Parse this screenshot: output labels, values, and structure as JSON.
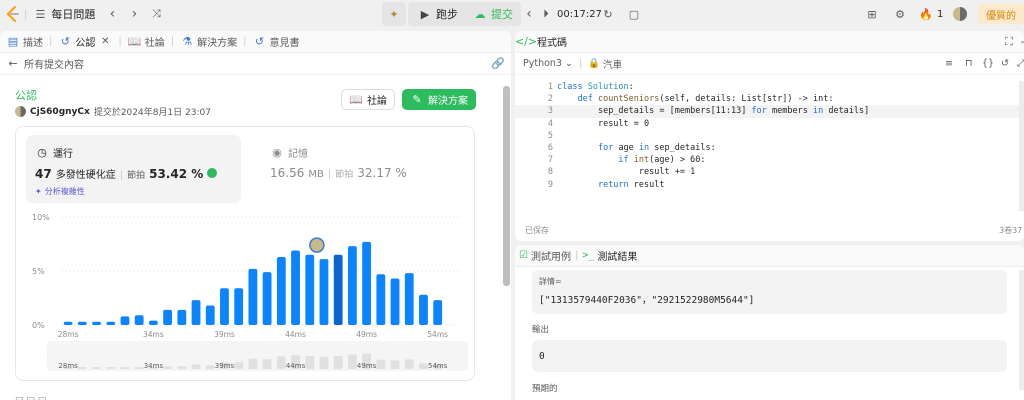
{
  "topbar": {
    "problem_list_label": "每日問題",
    "run_label": "跑步",
    "submit_label": "提交",
    "timer": "00:17:27",
    "streak": "1",
    "premium_label": "優質的"
  },
  "left_tabs": [
    {
      "label": "描述",
      "icon": "description-icon"
    },
    {
      "label": "公認",
      "icon": "history-icon"
    },
    {
      "label": "社論",
      "icon": "book-icon"
    },
    {
      "label": "解決方案",
      "icon": "flask-icon"
    },
    {
      "label": "意見書",
      "icon": "history-icon"
    }
  ],
  "back_label": "所有提交內容",
  "submission": {
    "status": "公認",
    "author": "CjS60gnyCx",
    "submitted_at": "提交於2024年8月1日 23:07",
    "forum_label": "社論",
    "solution_label": "解決方案"
  },
  "runtime": {
    "title": "運行",
    "value": "47",
    "unit": "多發性硬化症",
    "beats_label": "節拍",
    "beats_value": "53.42 %",
    "analyze_label": "分析複雜性"
  },
  "memory": {
    "title": "記憶",
    "value": "16.56",
    "unit": "MB",
    "beats_label": "節拍",
    "beats_value": "32.17 %"
  },
  "chart_data": {
    "type": "bar",
    "categories": [
      "28ms",
      "29ms",
      "30ms",
      "31ms",
      "32ms",
      "33ms",
      "34ms",
      "35ms",
      "36ms",
      "37ms",
      "38ms",
      "39ms",
      "40ms",
      "41ms",
      "42ms",
      "43ms",
      "44ms",
      "45ms",
      "46ms",
      "47ms",
      "48ms",
      "49ms",
      "50ms",
      "51ms",
      "52ms",
      "53ms",
      "54ms",
      "55ms"
    ],
    "values": [
      0.3,
      0.3,
      0.3,
      0.3,
      0.8,
      0.9,
      0.4,
      1.4,
      1.4,
      2.3,
      1.8,
      3.4,
      3.4,
      5.2,
      4.9,
      6.3,
      6.9,
      6.5,
      6.1,
      6.5,
      7.3,
      7.7,
      4.7,
      4.3,
      4.8,
      2.8,
      2.3,
      0
    ],
    "highlight_index": 19,
    "x_tick_labels": [
      "28ms",
      "34ms",
      "39ms",
      "44ms",
      "49ms",
      "54ms"
    ],
    "y_tick_labels": [
      "10%",
      "5%",
      "0%"
    ],
    "ylim": [
      0,
      10
    ],
    "grid": true,
    "overview_tick_labels": [
      "28ms",
      "34ms",
      "39ms",
      "44ms",
      "49ms",
      "54ms"
    ]
  },
  "editor": {
    "title": "程式碼",
    "language": "Python3",
    "mode": "汽車",
    "lines": [
      "class Solution:",
      "    def countSeniors(self, details: List[str]) -> int:",
      "        sep_details = [members[11:13] for members in details]",
      "        result = 0",
      "",
      "        for age in sep_details:",
      "            if int(age) > 60:",
      "                result += 1",
      "        return result"
    ],
    "saved_label": "已保存",
    "position_label": "3卷37"
  },
  "console": {
    "tab_cases": "測試用例",
    "tab_result": "測試結果",
    "details_label": "詳情=",
    "details_value": "[\"1313579440F2036\"，\"2921522980M5644\"]",
    "output_label": "輸出",
    "output_value": "0",
    "expected_label": "預期的"
  },
  "colors": {
    "accent_green": "#2cbb5d",
    "bar_blue": "#0a84ff",
    "bar_highlight": "#0a66cc",
    "bar_grey": "#e0e0e0"
  }
}
